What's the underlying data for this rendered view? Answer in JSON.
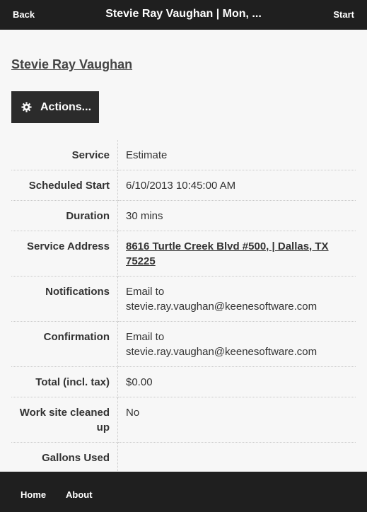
{
  "topbar": {
    "back_label": "Back",
    "title": "Stevie Ray Vaughan | Mon, ...",
    "start_label": "Start"
  },
  "customer_name": "Stevie Ray Vaughan",
  "actions_label": "Actions...",
  "details": [
    {
      "label": "Service",
      "value": "Estimate"
    },
    {
      "label": "Scheduled Start",
      "value": "6/10/2013 10:45:00 AM"
    },
    {
      "label": "Duration",
      "value": "30 mins"
    },
    {
      "label": "Service Address",
      "value": "8616 Turtle Creek Blvd #500, | Dallas, TX 75225"
    },
    {
      "label": "Notifications",
      "value": "Email to stevie.ray.vaughan@keenesoftware.com"
    },
    {
      "label": "Confirmation",
      "value": "Email to stevie.ray.vaughan@keenesoftware.com"
    },
    {
      "label": "Total (incl. tax)",
      "value": "$0.00"
    },
    {
      "label": "Work site cleaned up",
      "value": "No"
    },
    {
      "label": "Gallons Used",
      "value": ""
    }
  ],
  "footer": {
    "home_label": "Home",
    "about_label": "About"
  },
  "icons": {
    "actions": "gear-icon"
  }
}
